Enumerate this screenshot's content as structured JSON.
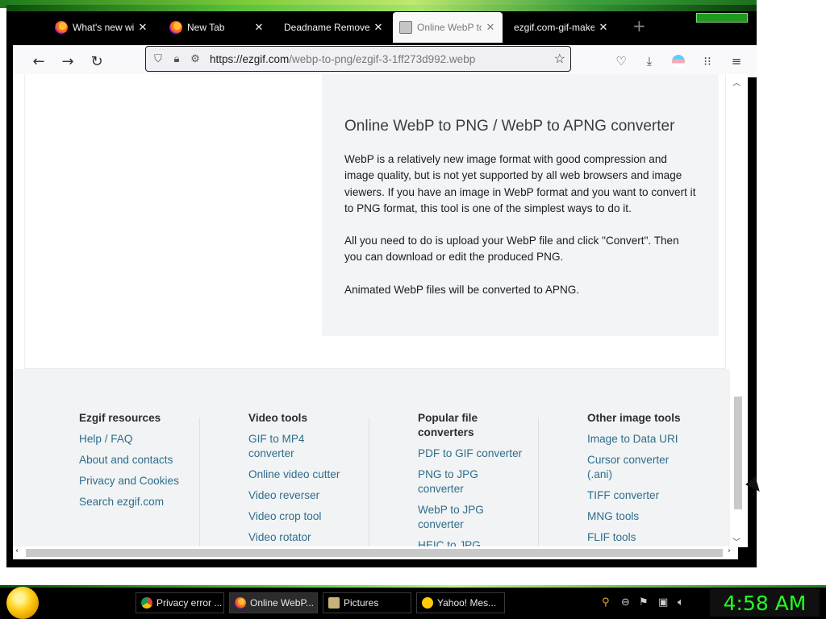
{
  "tabs": [
    {
      "label": "What's new with",
      "favicon": "firefox-icon",
      "active": false
    },
    {
      "label": "New Tab",
      "favicon": "firefox-icon",
      "active": false
    },
    {
      "label": "Deadname Remover",
      "favicon": "none",
      "active": false
    },
    {
      "label": "Online WebP to",
      "favicon": "page-icon",
      "active": true
    },
    {
      "label": "ezgif.com-gif-maker",
      "favicon": "none",
      "active": false
    }
  ],
  "url": {
    "host": "https://ezgif.com",
    "path": "/webp-to-png/ezgif-3-1ff273d992.webp"
  },
  "article": {
    "heading": "Online WebP to PNG / WebP to APNG converter",
    "p1": "WebP is a relatively new image format with good compression and image quality, but is not yet supported by all web browsers and image viewers. If you have an image in WebP format and you want to convert it to PNG format, this tool is one of the simplest ways to do it.",
    "p2": "All you need to do is upload your WebP file and click \"Convert\". Then you can download or edit the produced PNG.",
    "p3": "Animated WebP files will be converted to APNG."
  },
  "footer": {
    "col1": {
      "title": "Ezgif resources",
      "links": [
        "Help / FAQ",
        "About and contacts",
        "Privacy and Cookies",
        "Search ezgif.com"
      ]
    },
    "col2": {
      "title": "Video tools",
      "links": [
        "GIF to MP4 converter",
        "Online video cutter",
        "Video reverser",
        "Video crop tool",
        "Video rotator"
      ]
    },
    "col3": {
      "title": "Popular file converters",
      "links": [
        "PDF to GIF converter",
        "PNG to JPG converter",
        "WebP to JPG converter",
        "HEIC to JPG"
      ]
    },
    "col4": {
      "title": "Other image tools",
      "links": [
        "Image to Data URI",
        "Cursor converter (.ani)",
        "TIFF converter",
        "MNG tools",
        "FLIF tools"
      ]
    }
  },
  "taskbar": {
    "tasks": [
      {
        "label": "Privacy error ...",
        "icon": "chrome-icon"
      },
      {
        "label": "Online WebP...",
        "icon": "firefox-icon",
        "active": true
      },
      {
        "label": "Pictures",
        "icon": "folder-icon"
      },
      {
        "label": "Yahoo! Mes...",
        "icon": "yahoo-messenger-icon"
      }
    ],
    "clock": "4:58 AM"
  }
}
